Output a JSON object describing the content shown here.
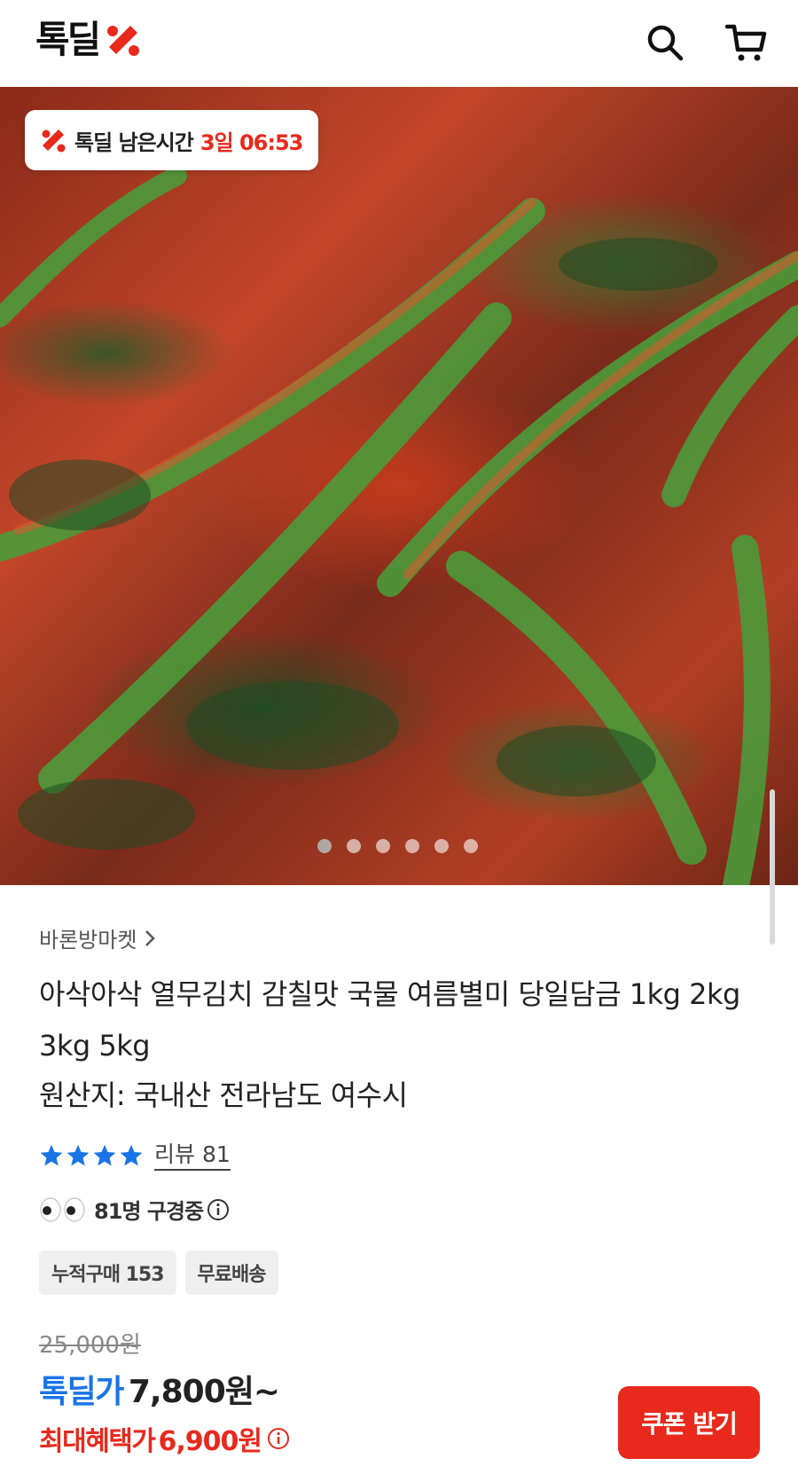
{
  "header": {
    "logo_text": "톡딜",
    "icons": [
      "search-icon",
      "cart-icon"
    ],
    "brand_color": "#e8291c"
  },
  "hero": {
    "timer_label": "톡딜 남은시간",
    "timer_value": "3일 06:53",
    "image_count": 6,
    "active_image_index": 0
  },
  "product": {
    "seller": "바론방마켓",
    "title": "아삭아삭 열무김치 감칠맛 국물 여름별미 당일담금 1kg 2kg 3kg 5kg",
    "origin": "원산지: 국내산 전라남도 여수시",
    "rating_stars": 4,
    "review_label": "리뷰 81",
    "watching": "81명 구경중",
    "badges": [
      "누적구매 153",
      "무료배송"
    ]
  },
  "price": {
    "original": "25,000원",
    "deal_label": "톡딜가",
    "deal_price": "7,800원~",
    "max_label": "최대혜택가",
    "max_price": "6,900원",
    "coupon_button": "쿠폰 받기",
    "deal_color": "#1a74e8",
    "accent_color": "#e8291c"
  }
}
